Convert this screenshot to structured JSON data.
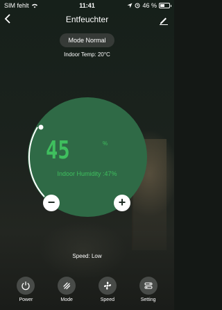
{
  "status_bar": {
    "carrier": "SIM fehlt",
    "time": "11:41",
    "battery": "46 %"
  },
  "header": {
    "title": "Entfeuchter"
  },
  "mode": {
    "label": "Mode Normal"
  },
  "indoor_temp": "Indoor Temp: 20°C",
  "dial": {
    "value": "45",
    "unit": "%",
    "humidity_label": "Indoor Humidity :47%",
    "decrease_label": "−",
    "increase_label": "+"
  },
  "speed_text": "Speed: Low",
  "controls": [
    {
      "label": "Power",
      "icon": "power-icon"
    },
    {
      "label": "Mode",
      "icon": "mode-icon"
    },
    {
      "label": "Speed",
      "icon": "fan-icon"
    },
    {
      "label": "Setting",
      "icon": "settings-icon"
    }
  ],
  "colors": {
    "dial": "#2f6a46",
    "accent_green": "#3fbf5e"
  }
}
